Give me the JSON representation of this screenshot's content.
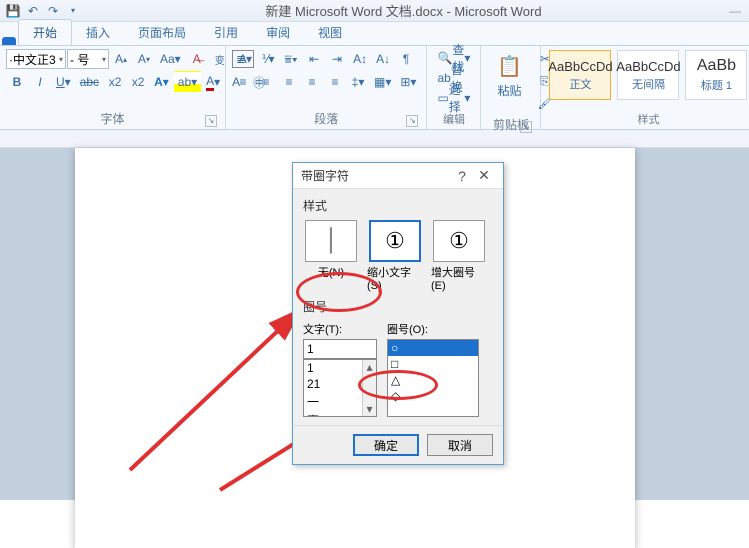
{
  "window": {
    "title": "新建 Microsoft Word 文档.docx - Microsoft Word"
  },
  "tabs": {
    "start": "开始",
    "insert": "插入",
    "layout": "页面布局",
    "ref": "引用",
    "review": "审阅",
    "view": "视图"
  },
  "font": {
    "family": "·中文正3",
    "size": "- 号",
    "group_label": "字体"
  },
  "para": {
    "group_label": "段落"
  },
  "edit": {
    "find": "查找",
    "replace": "替换",
    "select": "选择",
    "group_label": "编辑"
  },
  "clip": {
    "paste": "粘贴",
    "group_label": "剪贴板"
  },
  "styles": {
    "group_label": "样式",
    "items": [
      {
        "preview": "AaBbCcDd",
        "label": "正文"
      },
      {
        "preview": "AaBbCcDd",
        "label": "无间隔"
      },
      {
        "preview": "AaBb",
        "label": "标题 1"
      }
    ]
  },
  "dialog": {
    "title": "带圈字符",
    "sect_style": "样式",
    "opt_none": "无(N)",
    "opt_shrink": "缩小文字(S)",
    "opt_enlarge": "增大圈号(E)",
    "sect_num": "圈号",
    "text_label": "文字(T):",
    "ring_label": "圈号(O):",
    "text_value": "1",
    "text_items": [
      "1",
      "21",
      "一",
      "壹"
    ],
    "ring_items": [
      "○",
      "□",
      "△",
      "◇"
    ],
    "ok": "确定",
    "cancel": "取消"
  }
}
